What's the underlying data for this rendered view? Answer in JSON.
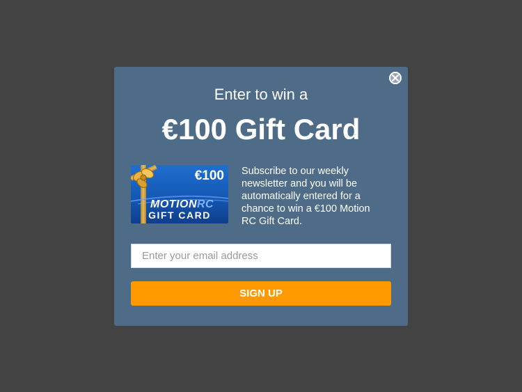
{
  "popup": {
    "headline_small": "Enter to win a",
    "headline_big": "€100 Gift Card",
    "description": "Subscribe to our weekly newsletter and you will be automatically entered for a chance to win a €100 Motion RC Gift Card.",
    "close_icon": "close-icon"
  },
  "gift_card": {
    "amount": "€100",
    "brand_motion": "MOTION",
    "brand_rc": "RC",
    "label": "GIFT CARD"
  },
  "form": {
    "email_placeholder": "Enter your email address",
    "email_value": "",
    "signup_label": "SIGN UP"
  },
  "colors": {
    "overlay": "#434343",
    "modal_bg": "#4e6c87",
    "button_bg": "#ff9900",
    "card_blue": "#1558b4"
  }
}
